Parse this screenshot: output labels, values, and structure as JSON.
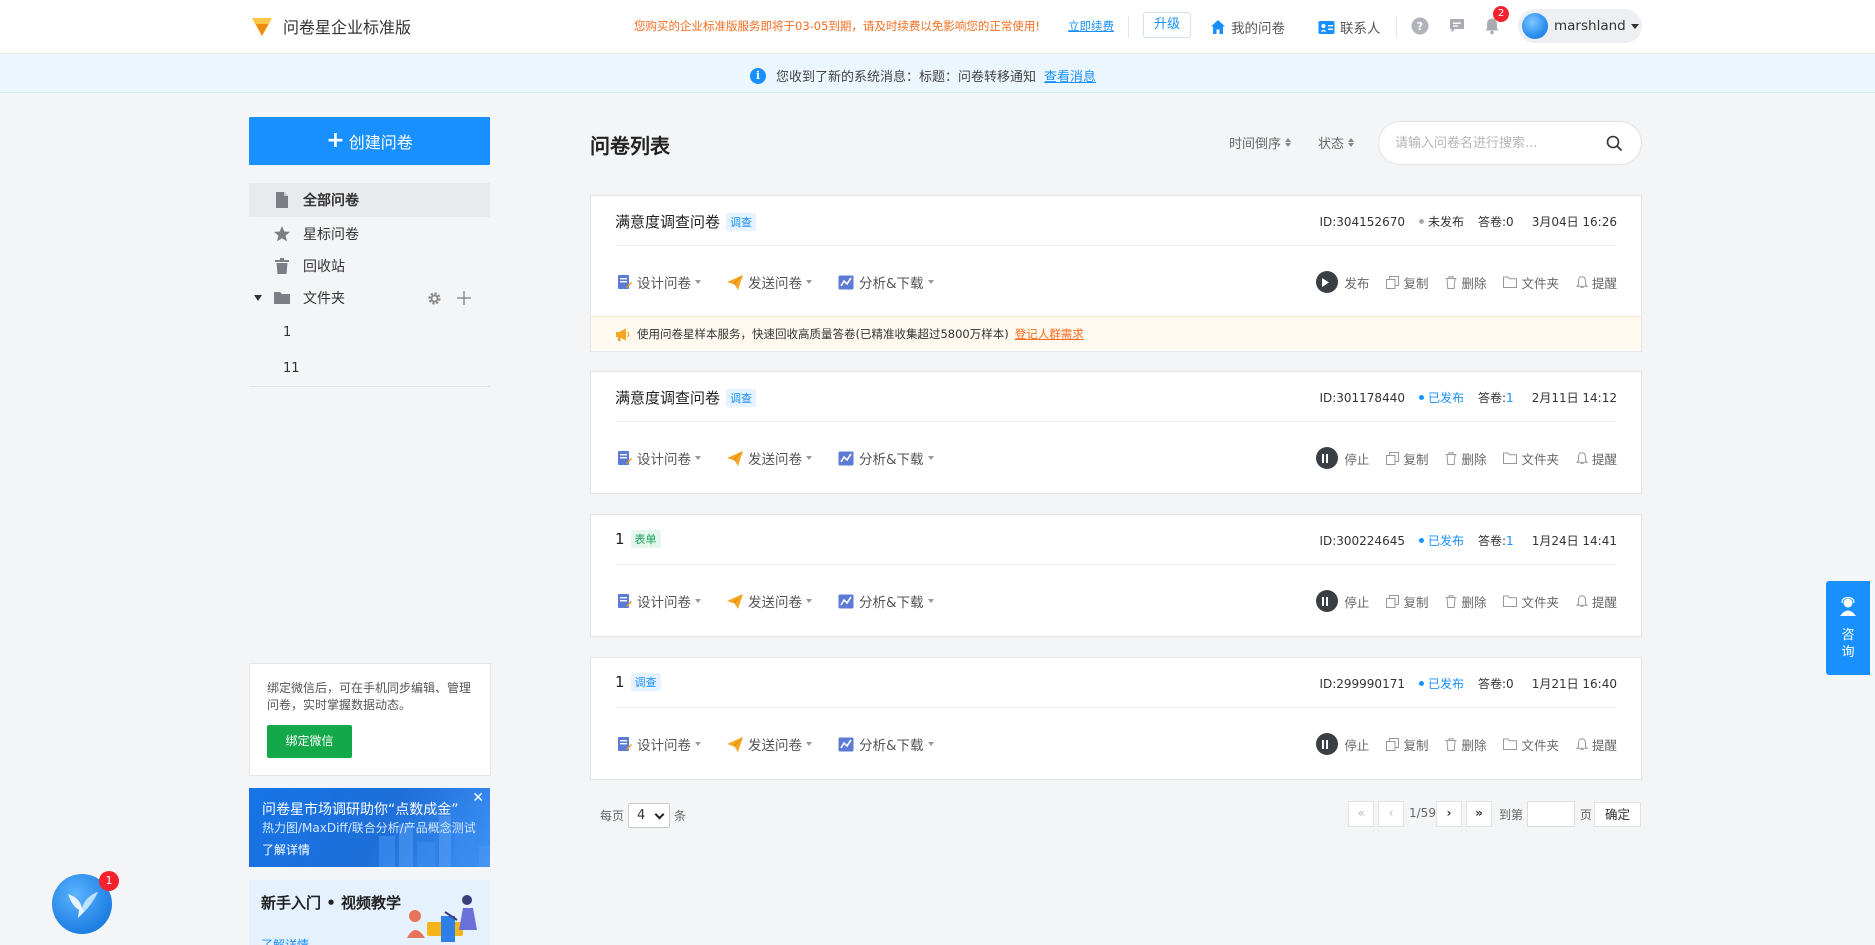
{
  "header": {
    "brand": "问卷星企业标准版",
    "renew_notice": "您购买的企业标准版服务即将于03-05到期，请及时续费以免影响您的正常使用!",
    "renew_link": "立即续费",
    "upgrade": "升级",
    "my_surveys": "我的问卷",
    "contacts": "联系人",
    "notification_count": "2",
    "username": "marshland"
  },
  "notice": {
    "text": "您收到了新的系统消息：标题：问卷转移通知",
    "link": "查看消息"
  },
  "sidebar": {
    "create": "创建问卷",
    "items": [
      {
        "label": "全部问卷",
        "icon": "document-icon"
      },
      {
        "label": "星标问卷",
        "icon": "star-icon"
      },
      {
        "label": "回收站",
        "icon": "trash-icon"
      }
    ],
    "folder": {
      "label": "文件夹",
      "subfolders": [
        "1",
        "11"
      ]
    },
    "wechat": {
      "text": "绑定微信后，可在手机同步编辑、管理问卷，实时掌握数据动态。",
      "button": "绑定微信"
    },
    "promo_market": {
      "title": "问卷星市场调研助你“点数成金”",
      "subtitle": "热力图/MaxDiff/联合分析/产品概念测试",
      "link": "了解详情"
    },
    "promo_tutorial": {
      "title": "新手入门 • 视频教学",
      "link": "了解详情"
    }
  },
  "main": {
    "title": "问卷列表",
    "sort_time": "时间倒序",
    "sort_status": "状态",
    "search_placeholder": "请输入问卷名进行搜索...",
    "action_labels": {
      "design": "设计问卷",
      "send": "发送问卷",
      "analyze": "分析&下载",
      "copy": "复制",
      "delete": "删除",
      "folder": "文件夹",
      "remind": "提醒"
    },
    "surveys": [
      {
        "title": "满意度调查问卷",
        "type": "调查",
        "id": "ID:304152670",
        "status": "未发布",
        "answers_label": "答卷:",
        "answers": "0",
        "date": "3月04日 16:26",
        "primary_op": "发布"
      },
      {
        "title": "满意度调查问卷",
        "type": "调查",
        "id": "ID:301178440",
        "status": "已发布",
        "answers_label": "答卷:",
        "answers": "1",
        "date": "2月11日 14:12",
        "primary_op": "停止"
      },
      {
        "title": "1",
        "type": "表单",
        "id": "ID:300224645",
        "status": "已发布",
        "answers_label": "答卷:",
        "answers": "1",
        "date": "1月24日 14:41",
        "primary_op": "停止"
      },
      {
        "title": "1",
        "type": "调查",
        "id": "ID:299990171",
        "status": "已发布",
        "answers_label": "答卷:",
        "answers": "0",
        "date": "1月21日 16:40",
        "primary_op": "停止"
      }
    ],
    "sample_promo": {
      "text": "使用问卷星样本服务，快速回收高质量答卷(已精准收集超过5800万样本)",
      "link": "登记人群需求"
    },
    "pagination": {
      "per_page_prefix": "每页",
      "per_page_value": "4",
      "per_page_suffix": "条",
      "page_info": "1/59",
      "goto_label": "到第",
      "page_unit": "页",
      "confirm": "确定"
    }
  },
  "float": {
    "consult": "咨询",
    "bird_badge": "1"
  },
  "colors": {
    "primary": "#1890ff",
    "warning": "#f56d1f",
    "wechat_green": "#13a84a",
    "status_published": "#1890ff",
    "status_unpublished": "#999999"
  }
}
